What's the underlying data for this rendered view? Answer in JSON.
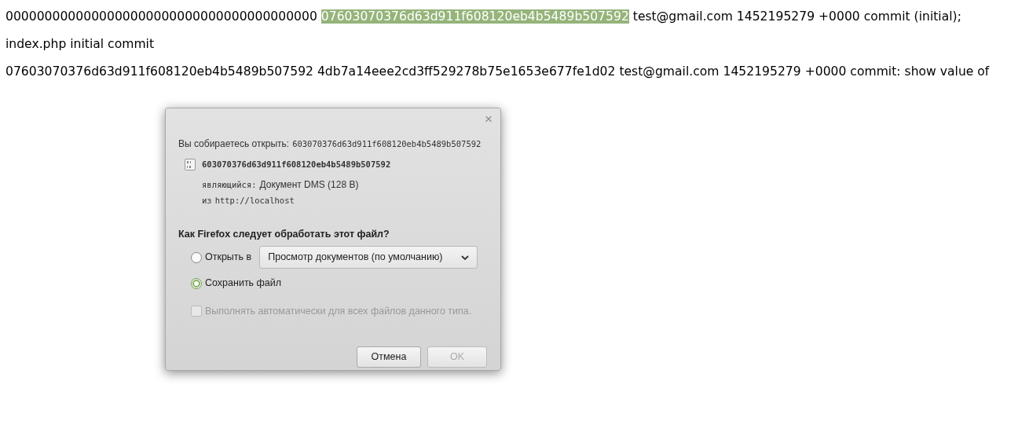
{
  "log_lines": [
    {
      "segments": [
        {
          "text": "0000000000000000000000000000000000000000",
          "selected": false
        },
        {
          "text": "07603070376d63d911f608120eb4b5489b507592",
          "selected": true
        },
        {
          "text": "test@gmail.com 1452195279 +0000 commit (initial);",
          "selected": false
        }
      ]
    },
    {
      "segments": [
        {
          "text": "index.php initial commit",
          "selected": false
        }
      ]
    },
    {
      "segments": [
        {
          "text": "07603070376d63d911f608120eb4b5489b507592 4db7a14eee2cd3ff529278b75e1653e677fe1d02 test@gmail.com 1452195279 +0000 commit: show value of",
          "selected": false
        }
      ]
    }
  ],
  "dialog": {
    "close": "×",
    "opening_label": "Вы собираетесь открыть:",
    "opening_file": "603070376d63d911f608120eb4b5489b507592",
    "file_name": "603070376d63d911f608120eb4b5489b507592",
    "type_label": "являющийся:",
    "type_value": "Документ DMS (128 В)",
    "from_label": "из",
    "from_value": "http://localhost",
    "question": "Как Firefox следует обработать этот файл?",
    "options": [
      {
        "kind": "open",
        "label": "Открыть в",
        "selected": false,
        "app": "Просмотр документов (по умолчанию)"
      },
      {
        "kind": "save",
        "label": "Сохранить файл",
        "selected": true
      }
    ],
    "auto": {
      "label": "Выполнять автоматически для всех файлов данного типа.",
      "checked": false,
      "disabled": true
    },
    "buttons": [
      {
        "label": "Отмена",
        "disabled": false
      },
      {
        "label": "OK",
        "disabled": true
      }
    ]
  }
}
